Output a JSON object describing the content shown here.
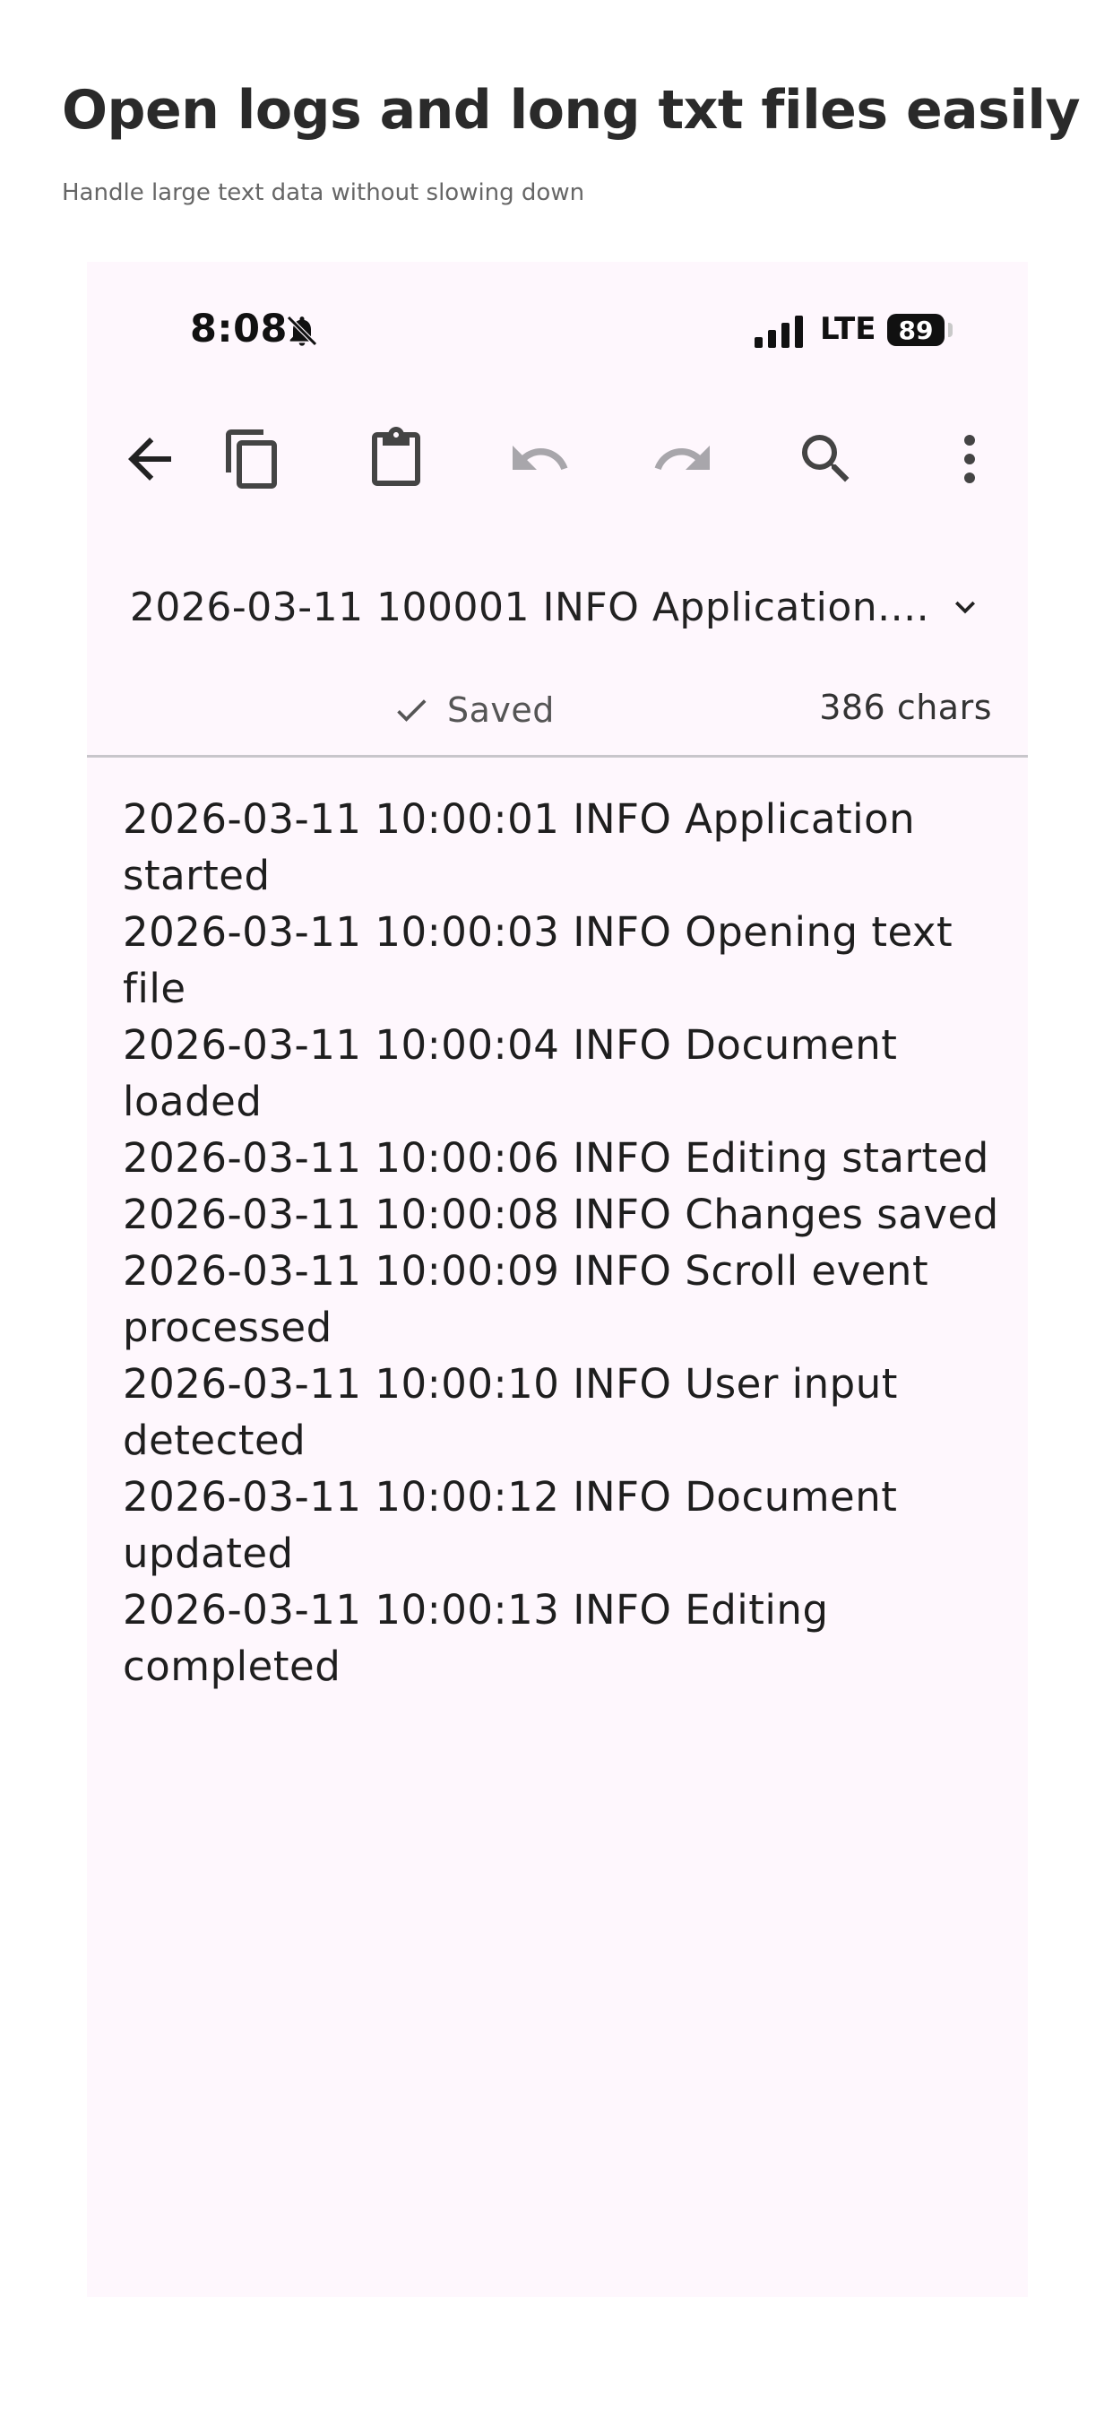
{
  "hero": {
    "title": "Open logs and long txt files easily",
    "subtitle": "Handle large text data without slowing down"
  },
  "status_bar": {
    "time": "8:08",
    "network": "LTE",
    "battery": "89"
  },
  "toolbar": {
    "icons": [
      "back-arrow-icon",
      "copy-icon",
      "paste-clipboard-icon",
      "undo-icon",
      "redo-icon",
      "search-icon",
      "more-vert-icon"
    ]
  },
  "document": {
    "title": "2026-03-11 100001 INFO Application....",
    "saved_label": "Saved",
    "char_count": "386 chars",
    "lines": [
      "2026-03-11 10:00:01 INFO Application started",
      "2026-03-11 10:00:03 INFO Opening text file",
      "2026-03-11 10:00:04 INFO Document loaded",
      "2026-03-11 10:00:06 INFO Editing started",
      "2026-03-11 10:00:08 INFO Changes saved",
      "2026-03-11 10:00:09 INFO Scroll event processed",
      "2026-03-11 10:00:10 INFO User input detected",
      "2026-03-11 10:00:12 INFO Document updated",
      "2026-03-11 10:00:13 INFO Editing completed"
    ]
  },
  "colors": {
    "surface": "#fef7fd",
    "disabled_icon": "#a8a6ab",
    "icon": "#444444"
  }
}
